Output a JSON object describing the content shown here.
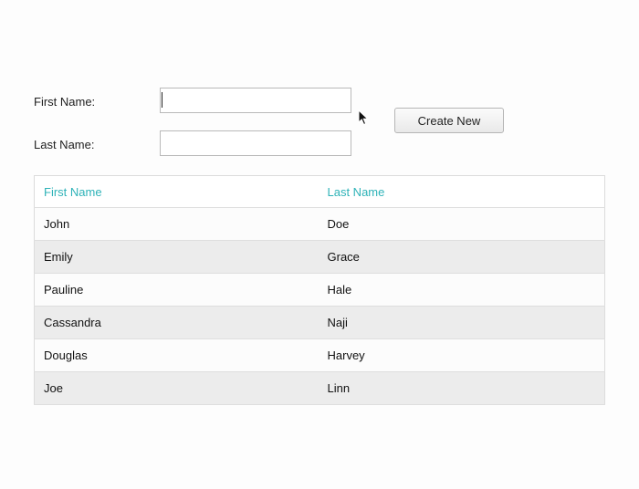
{
  "form": {
    "first_name_label": "First Name:",
    "last_name_label": "Last Name:",
    "first_name_value": "",
    "last_name_value": "",
    "create_button_label": "Create New"
  },
  "table": {
    "headers": [
      "First Name",
      "Last Name"
    ],
    "rows": [
      [
        "John",
        "Doe"
      ],
      [
        "Emily",
        "Grace"
      ],
      [
        "Pauline",
        "Hale"
      ],
      [
        "Cassandra",
        "Naji"
      ],
      [
        "Douglas",
        "Harvey"
      ],
      [
        "Joe",
        "Linn"
      ]
    ]
  },
  "colors": {
    "header_text": "#2fb3b8",
    "stripe": "#ececec"
  },
  "icons": {
    "pointer": "mouse-pointer-icon"
  }
}
